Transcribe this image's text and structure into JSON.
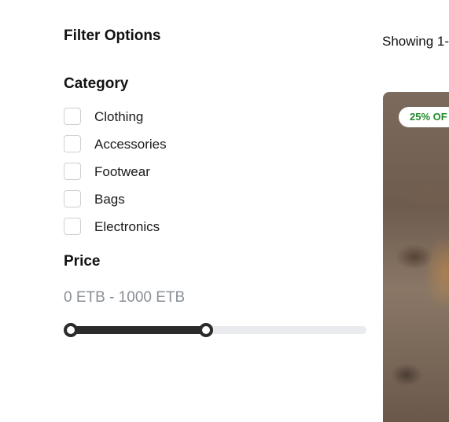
{
  "filters": {
    "title": "Filter Options",
    "category": {
      "title": "Category",
      "items": [
        {
          "label": "Clothing",
          "checked": false
        },
        {
          "label": "Accessories",
          "checked": false
        },
        {
          "label": "Footwear",
          "checked": false
        },
        {
          "label": "Bags",
          "checked": false
        },
        {
          "label": "Electronics",
          "checked": false
        }
      ]
    },
    "price": {
      "title": "Price",
      "range_text": "0 ETB - 1000 ETB",
      "min_value": 0,
      "max_value": 1000,
      "currency": "ETB",
      "slider_fill_fraction": 0.47
    }
  },
  "results": {
    "count_text": "Showing 1-"
  },
  "product_card": {
    "badge": "25% OF",
    "badge_color": "#1f8a2a"
  },
  "colors": {
    "slider_active": "#2b2b2b",
    "slider_track": "#e9ebee",
    "muted_text": "#8a8f96"
  }
}
